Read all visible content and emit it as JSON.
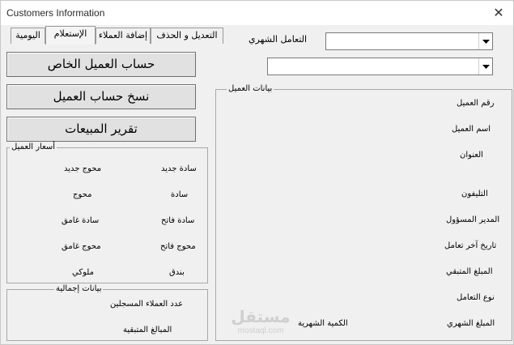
{
  "window": {
    "title": "Customers Information",
    "close_glyph": "✕"
  },
  "tabs": [
    {
      "label": "التعديل و الحذف"
    },
    {
      "label": "إضافة العملاء"
    },
    {
      "label": "الإستعلام"
    },
    {
      "label": "اليومية"
    }
  ],
  "buttons": {
    "private_account": "حساب العميل الخاص",
    "copy_account": "نسخ حساب العميل",
    "sales_report": "تقرير المبيعات"
  },
  "monthly": {
    "label": "التعامل الشهري",
    "combo1_value": "",
    "combo2_value": ""
  },
  "prices": {
    "title": "أسعار العميل",
    "items": [
      "سادة جديد",
      "محوج جديد",
      "سادة",
      "محوج",
      "سادة فاتح",
      "سادة غامق",
      "محوج فاتح",
      "محوج غامق",
      "بندق",
      "ملوكي"
    ]
  },
  "totals": {
    "title": "بيانات إجمالية",
    "registered_count": "عدد العملاء المسجلين",
    "remaining_amounts": "المبالغ المتبقية"
  },
  "customer": {
    "title": "بيانات العميل",
    "fields": [
      "رقم العميل",
      "اسم العميل",
      "العنوان",
      "التليفون",
      "المدير المسؤول",
      "تاريخ آخر تعامل",
      "المبلغ المتبقي",
      "نوع التعامل",
      "المبلغ الشهري"
    ],
    "monthly_quantity": "الكمية الشهرية"
  },
  "watermark": {
    "ar": "مستقل",
    "en": "mostaql.com"
  }
}
